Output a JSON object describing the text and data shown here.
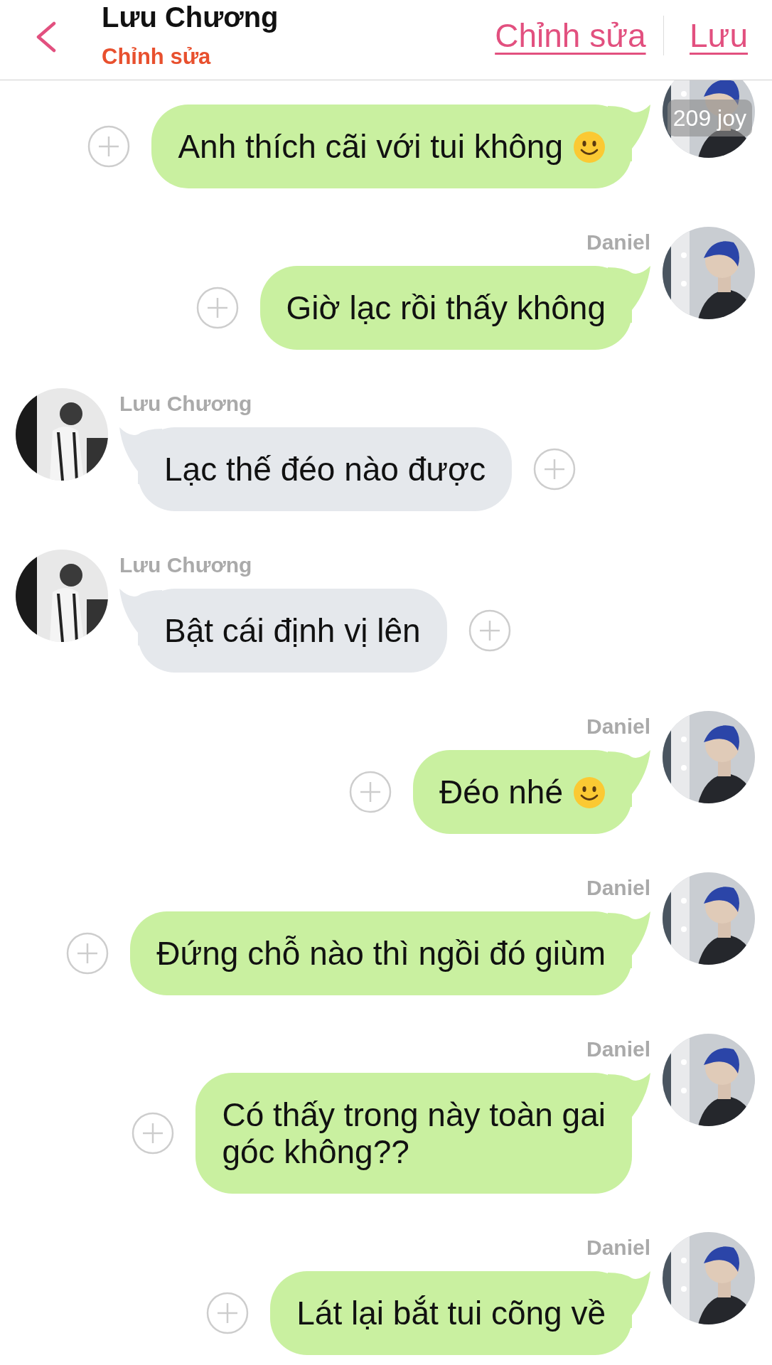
{
  "header": {
    "title": "Lưu Chương",
    "subtitle": "Chỉnh sửa",
    "actions": [
      "Chỉnh sửa",
      "Lưu"
    ]
  },
  "messages": [
    {
      "kind": "sent",
      "lines": [
        "Anh thích cãi với tui không"
      ],
      "emoji": true,
      "badge": "209 joy"
    },
    {
      "kind": "sent",
      "name": "Daniel",
      "lines": [
        "Giờ lạc rồi thấy không"
      ],
      "emoji": false
    },
    {
      "kind": "received",
      "name": "Lưu Chương",
      "lines": [
        "Lạc thế đéo nào được"
      ],
      "emoji": false
    },
    {
      "kind": "received",
      "name": "Lưu Chương",
      "lines": [
        "Bật cái định vị lên"
      ],
      "emoji": false
    },
    {
      "kind": "sent",
      "name": "Daniel",
      "lines": [
        "Đéo nhé"
      ],
      "emoji": true
    },
    {
      "kind": "sent",
      "name": "Daniel",
      "lines": [
        "Đứng chỗ nào thì ngồi đó giùm"
      ],
      "emoji": false
    },
    {
      "kind": "sent",
      "name": "Daniel",
      "lines": [
        "Có thấy trong này toàn gai",
        "góc không??"
      ],
      "emoji": false
    },
    {
      "kind": "sent",
      "name": "Daniel",
      "lines": [
        "Lát lại bắt tui cõng về"
      ],
      "emoji": false
    }
  ]
}
